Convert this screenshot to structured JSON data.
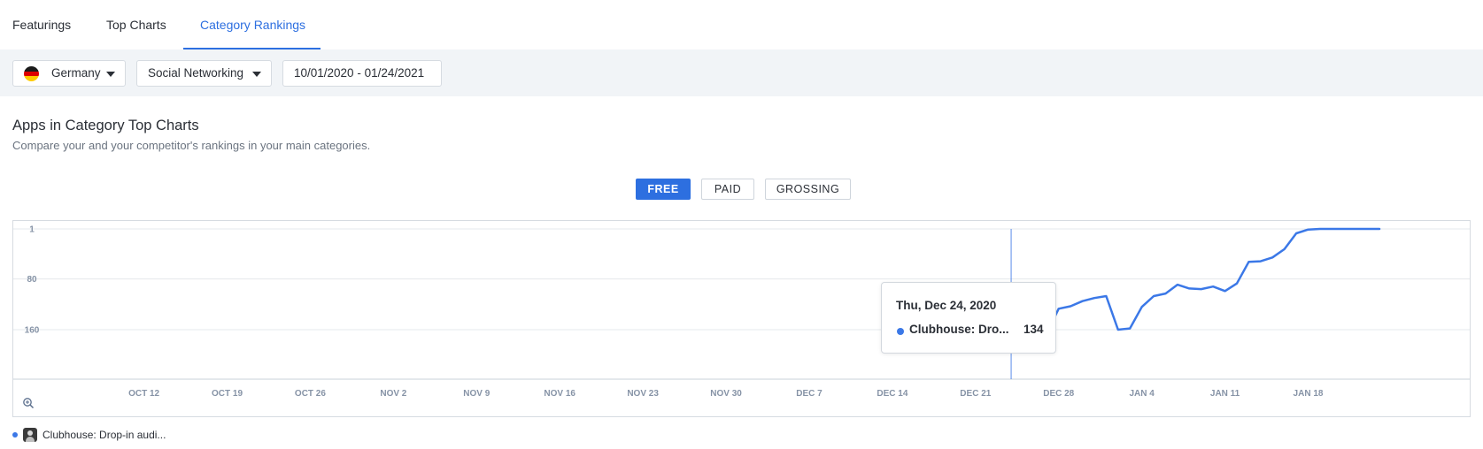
{
  "tabs": [
    {
      "label": "Featurings",
      "active": false
    },
    {
      "label": "Top Charts",
      "active": false
    },
    {
      "label": "Category Rankings",
      "active": true
    }
  ],
  "filters": {
    "country": "Germany",
    "category": "Social Networking",
    "date_range": "10/01/2020 - 01/24/2021"
  },
  "section": {
    "title": "Apps in Category Top Charts",
    "subtitle": "Compare your and your competitor's rankings in your main categories."
  },
  "chart_types": [
    {
      "label": "FREE",
      "active": true
    },
    {
      "label": "PAID",
      "active": false
    },
    {
      "label": "GROSSING",
      "active": false
    }
  ],
  "colors": {
    "accent": "#2d6fe0",
    "series": "#3b78e7"
  },
  "tooltip": {
    "date": "Thu, Dec 24, 2020",
    "series_name": "Clubhouse: Dro...",
    "value": "134"
  },
  "legend": {
    "name": "Clubhouse: Drop-in audi..."
  },
  "icons": {
    "zoom": "zoom-in-icon",
    "app": "clubhouse-app-icon",
    "flag": "germany-flag-icon"
  },
  "chart_data": {
    "type": "line",
    "y_inverted": true,
    "ylim": [
      1,
      240
    ],
    "yticks": [
      1,
      80,
      160
    ],
    "xlim": [
      "2020-10-01",
      "2021-01-24"
    ],
    "xticks": [
      "2020-10-12",
      "2020-10-19",
      "2020-10-26",
      "2020-11-02",
      "2020-11-09",
      "2020-11-16",
      "2020-11-23",
      "2020-11-30",
      "2020-12-07",
      "2020-12-14",
      "2020-12-21",
      "2020-12-28",
      "2021-01-04",
      "2021-01-11",
      "2021-01-18"
    ],
    "xtick_labels": [
      "OCT 12",
      "OCT 19",
      "OCT 26",
      "NOV 2",
      "NOV 9",
      "NOV 16",
      "NOV 23",
      "NOV 30",
      "DEC 7",
      "DEC 14",
      "DEC 21",
      "DEC 28",
      "JAN 4",
      "JAN 11",
      "JAN 18"
    ],
    "highlight": {
      "x": "2020-12-24",
      "y": 134
    },
    "series": [
      {
        "name": "Clubhouse: Drop-in audi...",
        "points": [
          [
            "2020-12-24",
            134
          ],
          [
            "2020-12-25",
            134
          ],
          [
            "2020-12-26",
            155
          ],
          [
            "2020-12-27",
            166
          ],
          [
            "2020-12-28",
            127
          ],
          [
            "2020-12-29",
            123
          ],
          [
            "2020-12-30",
            115
          ],
          [
            "2020-12-31",
            110
          ],
          [
            "2021-01-01",
            107
          ],
          [
            "2021-01-02",
            160
          ],
          [
            "2021-01-03",
            158
          ],
          [
            "2021-01-04",
            124
          ],
          [
            "2021-01-05",
            107
          ],
          [
            "2021-01-06",
            103
          ],
          [
            "2021-01-07",
            89
          ],
          [
            "2021-01-08",
            95
          ],
          [
            "2021-01-09",
            96
          ],
          [
            "2021-01-10",
            92
          ],
          [
            "2021-01-11",
            99
          ],
          [
            "2021-01-12",
            87
          ],
          [
            "2021-01-13",
            53
          ],
          [
            "2021-01-14",
            52
          ],
          [
            "2021-01-15",
            46
          ],
          [
            "2021-01-16",
            33
          ],
          [
            "2021-01-17",
            8
          ],
          [
            "2021-01-18",
            2
          ],
          [
            "2021-01-19",
            1
          ],
          [
            "2021-01-20",
            1
          ],
          [
            "2021-01-21",
            1
          ],
          [
            "2021-01-22",
            1
          ],
          [
            "2021-01-23",
            1
          ],
          [
            "2021-01-24",
            1
          ]
        ]
      }
    ]
  }
}
